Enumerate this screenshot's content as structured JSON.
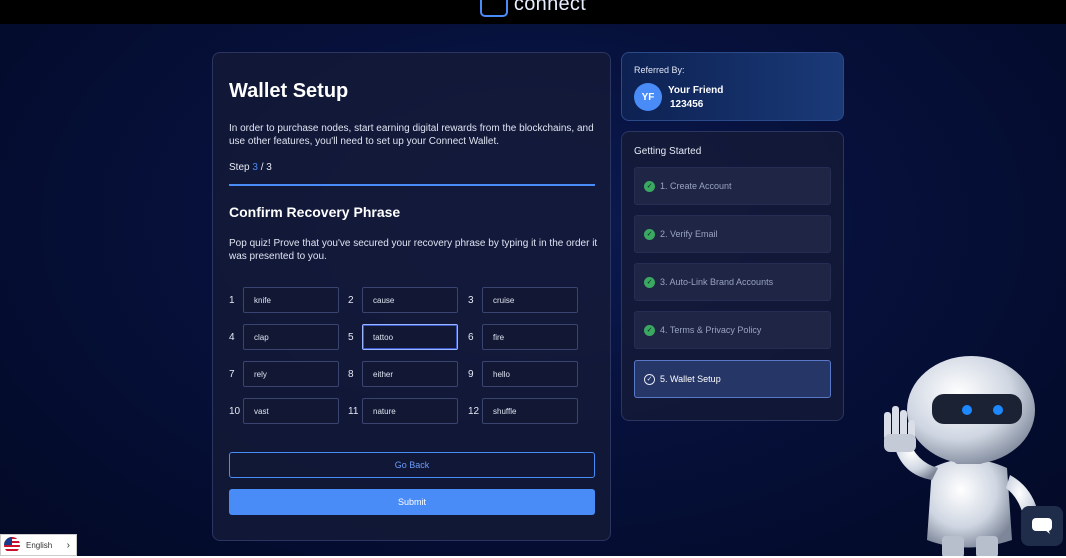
{
  "header": {
    "brand": "connect"
  },
  "wallet": {
    "title": "Wallet Setup",
    "intro": "In order to purchase nodes, start earning digital rewards from the blockchains, and use other features, you'll need to set up your Connect Wallet.",
    "step_prefix": "Step ",
    "step_current": "3",
    "step_sep": " / ",
    "step_total": "3",
    "progress": 1.0,
    "subtitle": "Confirm Recovery Phrase",
    "quiz_text": "Pop quiz! Prove that you've secured your recovery phrase by typing it in the order it was presented to you.",
    "words": [
      {
        "num": "1",
        "value": "knife"
      },
      {
        "num": "2",
        "value": "cause"
      },
      {
        "num": "3",
        "value": "cruise"
      },
      {
        "num": "4",
        "value": "clap"
      },
      {
        "num": "5",
        "value": "tattoo"
      },
      {
        "num": "6",
        "value": "fire"
      },
      {
        "num": "7",
        "value": "rely"
      },
      {
        "num": "8",
        "value": "either"
      },
      {
        "num": "9",
        "value": "hello"
      },
      {
        "num": "10",
        "value": "vast"
      },
      {
        "num": "11",
        "value": "nature"
      },
      {
        "num": "12",
        "value": "shuffle"
      }
    ],
    "back_label": "Go Back",
    "submit_label": "Submit"
  },
  "referral": {
    "label": "Referred By:",
    "initials": "YF",
    "name": "Your Friend",
    "code": "123456"
  },
  "getting_started": {
    "title": "Getting Started",
    "steps": [
      {
        "label": "1. Create Account",
        "state": "done"
      },
      {
        "label": "2. Verify Email",
        "state": "done"
      },
      {
        "label": "3. Auto-Link Brand Accounts",
        "state": "done"
      },
      {
        "label": "4. Terms & Privacy Policy",
        "state": "done"
      },
      {
        "label": "5. Wallet Setup",
        "state": "current"
      }
    ]
  },
  "language": {
    "label": "English"
  },
  "colors": {
    "accent": "#4a8cf7",
    "success": "#3aa860",
    "background": "#06103a"
  }
}
